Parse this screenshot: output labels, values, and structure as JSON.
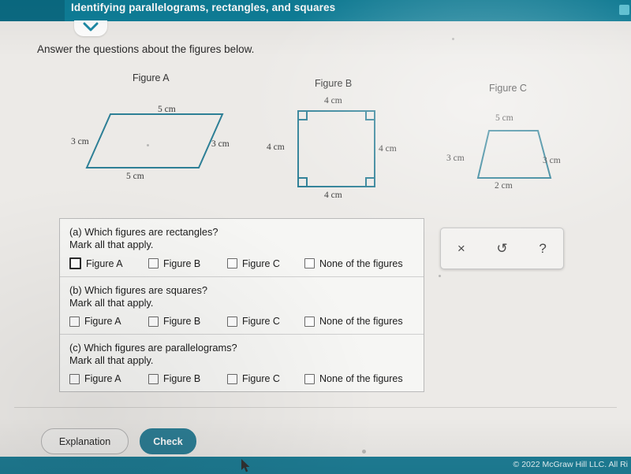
{
  "topbar": {
    "title": "Identifying parallelograms, rectangles, and squares",
    "chevron_icon": "chevron-down-icon"
  },
  "instruction": "Answer the questions about the figures below.",
  "figures": [
    {
      "label": "Figure A",
      "shape": "parallelogram",
      "sides": {
        "top": "5 cm",
        "left": "3 cm",
        "right": "3 cm",
        "bottom": "5 cm"
      }
    },
    {
      "label": "Figure B",
      "shape": "square",
      "sides": {
        "top": "4 cm",
        "left": "4 cm",
        "right": "4 cm",
        "bottom": "4 cm"
      }
    },
    {
      "label": "Figure C",
      "shape": "trapezoid",
      "sides": {
        "top": "5 cm",
        "left": "3 cm",
        "right": "3 cm",
        "bottom": "2 cm"
      }
    }
  ],
  "questions": [
    {
      "prompt": "(a) Which figures are rectangles?",
      "subprompt": "Mark all that apply.",
      "options": [
        "Figure A",
        "Figure B",
        "Figure C",
        "None of the figures"
      ]
    },
    {
      "prompt": "(b) Which figures are squares?",
      "subprompt": "Mark all that apply.",
      "options": [
        "Figure A",
        "Figure B",
        "Figure C",
        "None of the figures"
      ]
    },
    {
      "prompt": "(c) Which figures are parallelograms?",
      "subprompt": "Mark all that apply.",
      "options": [
        "Figure A",
        "Figure B",
        "Figure C",
        "None of the figures"
      ]
    }
  ],
  "toolbox": {
    "clear_label": "×",
    "undo_label": "↺",
    "help_label": "?",
    "icons": [
      "clear-icon",
      "undo-icon",
      "help-icon"
    ]
  },
  "buttons": {
    "explanation": "Explanation",
    "check": "Check"
  },
  "footer": {
    "copyright": "© 2022 McGraw Hill LLC. All Ri"
  },
  "colors": {
    "teal": "#0f7f99",
    "figure_stroke": "#2d7f96",
    "check_button": "#2d7f96"
  }
}
